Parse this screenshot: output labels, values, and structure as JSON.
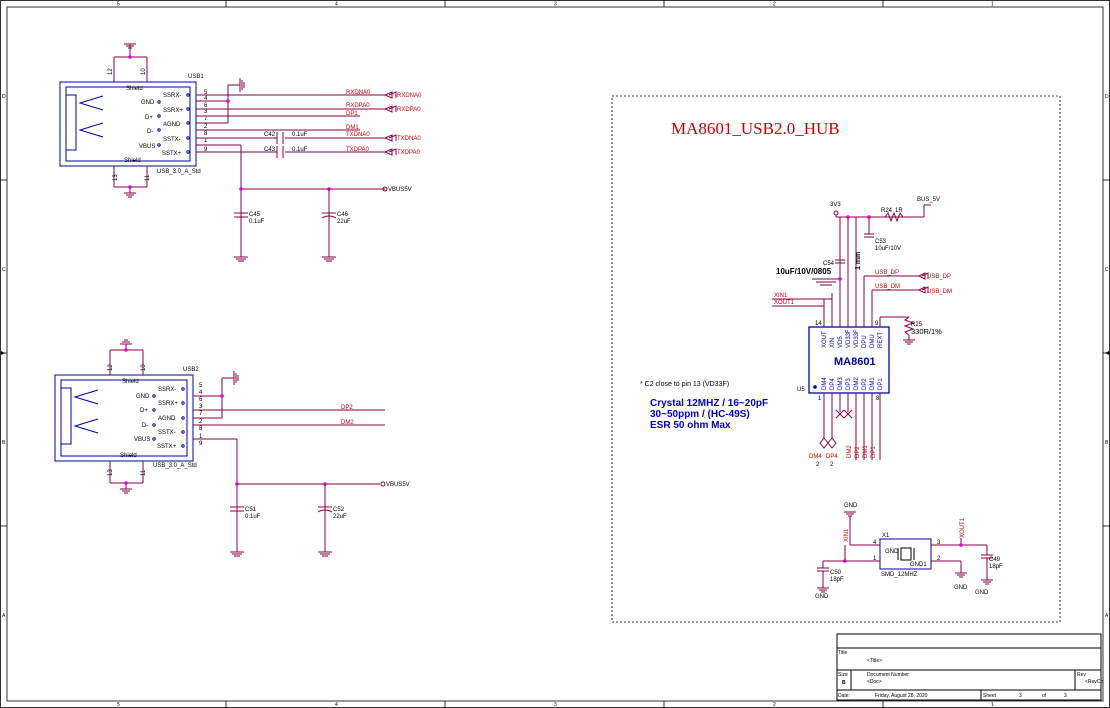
{
  "frame": {
    "col_labels": [
      "5",
      "4",
      "3",
      "2",
      "1"
    ],
    "row_labels": [
      "D",
      "C",
      "B",
      "A"
    ]
  },
  "usb1": {
    "ref": "USB1",
    "part": "USB_3.0_A_Std",
    "pins": [
      {
        "name": "SSRX-",
        "num": "5"
      },
      {
        "name": "GND",
        "num": "4"
      },
      {
        "name": "SSRX+",
        "num": "6"
      },
      {
        "name": "D+",
        "num": "3"
      },
      {
        "name": "AGND",
        "num": "7"
      },
      {
        "name": "D-",
        "num": "2"
      },
      {
        "name": "SSTX-",
        "num": "8"
      },
      {
        "name": "VBUS",
        "num": "1"
      },
      {
        "name": "SSTX+",
        "num": "9"
      }
    ],
    "shield_top": "Shield",
    "shield_bottom": "Shield",
    "shield_pins_top": [
      "12",
      "10"
    ],
    "shield_pins_bottom": [
      "13",
      "11"
    ],
    "nets": {
      "rxdna0": "RXDNA0",
      "rxdpa0": "RXDPA0",
      "dp1": "DP1",
      "dm1": "DM1",
      "txdna0": "TXDNA0",
      "txdpa0": "TXDPA0",
      "port_rxdna0": "RXDNA0",
      "port_rxdpa0": "RXDPA0",
      "port_txdna0": "TXDNA0",
      "port_txdpa0": "TXDPA0",
      "vbus": "VBUS5V"
    },
    "caps": {
      "c42_ref": "C42",
      "c42_val": "0.1uF",
      "c43_ref": "C43",
      "c43_val": "0.1uF",
      "c45_ref": "C45",
      "c45_val": "0.1uF",
      "c46_ref": "C46",
      "c46_val": "22uF"
    }
  },
  "usb2": {
    "ref": "USB2",
    "part": "USB_3.0_A_Std",
    "pins": [
      {
        "name": "SSRX-",
        "num": "5"
      },
      {
        "name": "GND",
        "num": "4"
      },
      {
        "name": "SSRX+",
        "num": "6"
      },
      {
        "name": "D+",
        "num": "3"
      },
      {
        "name": "AGND",
        "num": "7"
      },
      {
        "name": "D-",
        "num": "2"
      },
      {
        "name": "SSTX-",
        "num": "8"
      },
      {
        "name": "VBUS",
        "num": "1"
      },
      {
        "name": "SSTX+",
        "num": "9"
      }
    ],
    "shield_top": "Shield",
    "shield_bottom": "Shield",
    "shield_pins_top": [
      "12",
      "10"
    ],
    "shield_pins_bottom": [
      "13",
      "11"
    ],
    "nets": {
      "dp2": "DP2",
      "dm2": "DM2",
      "vbus": "VBUS5V"
    },
    "caps": {
      "c51_ref": "C51",
      "c51_val": "0.1uF",
      "c52_ref": "C52",
      "c52_val": "22uF"
    }
  },
  "hub": {
    "title": "MA8601_USB2.0_HUB",
    "chip_name": "MA8601",
    "chip_ref": "U5",
    "top_pins": [
      "XOUT",
      "XIN",
      "VD5",
      "VD33F",
      "VD33F",
      "DPU",
      "DMU",
      "REXT"
    ],
    "top_nums": [
      "14",
      "",
      "",
      "",
      "",
      "",
      "",
      "9"
    ],
    "bottom_pins": [
      "DM4",
      "DP4",
      "DM3",
      "DP3",
      "DM2",
      "DP2",
      "DM1",
      "DP1"
    ],
    "bottom_nums": [
      "1",
      "",
      "",
      "",
      "",
      "",
      "",
      "8"
    ],
    "net_3v3": "3V3",
    "net_bus5v": "BUS_5V",
    "r24_ref": "R24",
    "r24_val": "1R",
    "c53_ref": "C53",
    "c53_val": "10uF/10V",
    "c54_ref": "C54",
    "c54_val": "10uF/10V/0805",
    "dim_label": "1 mm",
    "usb_dp": "USB_DP",
    "usb_dm": "USB_DM",
    "port_usb_dp": "USB_DP",
    "port_usb_dm": "USB_DM",
    "xin1": "XIN1",
    "xout1": "XOUT1",
    "r25_ref": "R25",
    "r25_val": "330R/1%",
    "bottom_nets": [
      "DM4",
      "DP4",
      "DM2",
      "DP2",
      "DM1",
      "DP1"
    ],
    "dm4_label": "DM4",
    "dp4_label": "DP4",
    "dm4_num": "2",
    "dp4_num": "2",
    "note": "* C2 close to pin 13 (VD33F)",
    "crystal_lines": [
      "Crystal 12MHZ / 16~20pF",
      "30~50ppm / (HC-49S)",
      "ESR 50 ohm Max"
    ]
  },
  "crystal": {
    "gnd_top": "GND",
    "xin": "XIN1",
    "xout": "XOUT1",
    "x_ref": "X1",
    "x_pin_gnd": "GND",
    "x_pin_gnd1": "GND1",
    "x_part": "SMD_12MHZ",
    "pin4": "4",
    "pin3": "3",
    "pin1": "1",
    "pin2": "2",
    "c50_ref": "C50",
    "c50_val": "18pF",
    "c49_ref": "C49",
    "c49_val": "18pF",
    "gnd_a": "GND",
    "gnd_b": "GND",
    "gnd_c": "GND"
  },
  "title_block": {
    "title_label": "Title",
    "title_value": "<Title>",
    "size_label": "Size",
    "size_value": "B",
    "docnum_label": "Document Number",
    "docnum_value": "<Doc>",
    "rev_label": "Rev",
    "rev_value": "<RevCo",
    "date_label": "Date:",
    "date_value": "Friday, August 28, 2020",
    "sheet_label": "Sheet",
    "sheet_num": "3",
    "of_label": "of",
    "sheet_total": "3"
  },
  "colors": {
    "wire": "#8a0045",
    "net": "#cc0000",
    "body": "#0000aa",
    "junction": "#e000e0",
    "text_blue": "#0000cc"
  }
}
